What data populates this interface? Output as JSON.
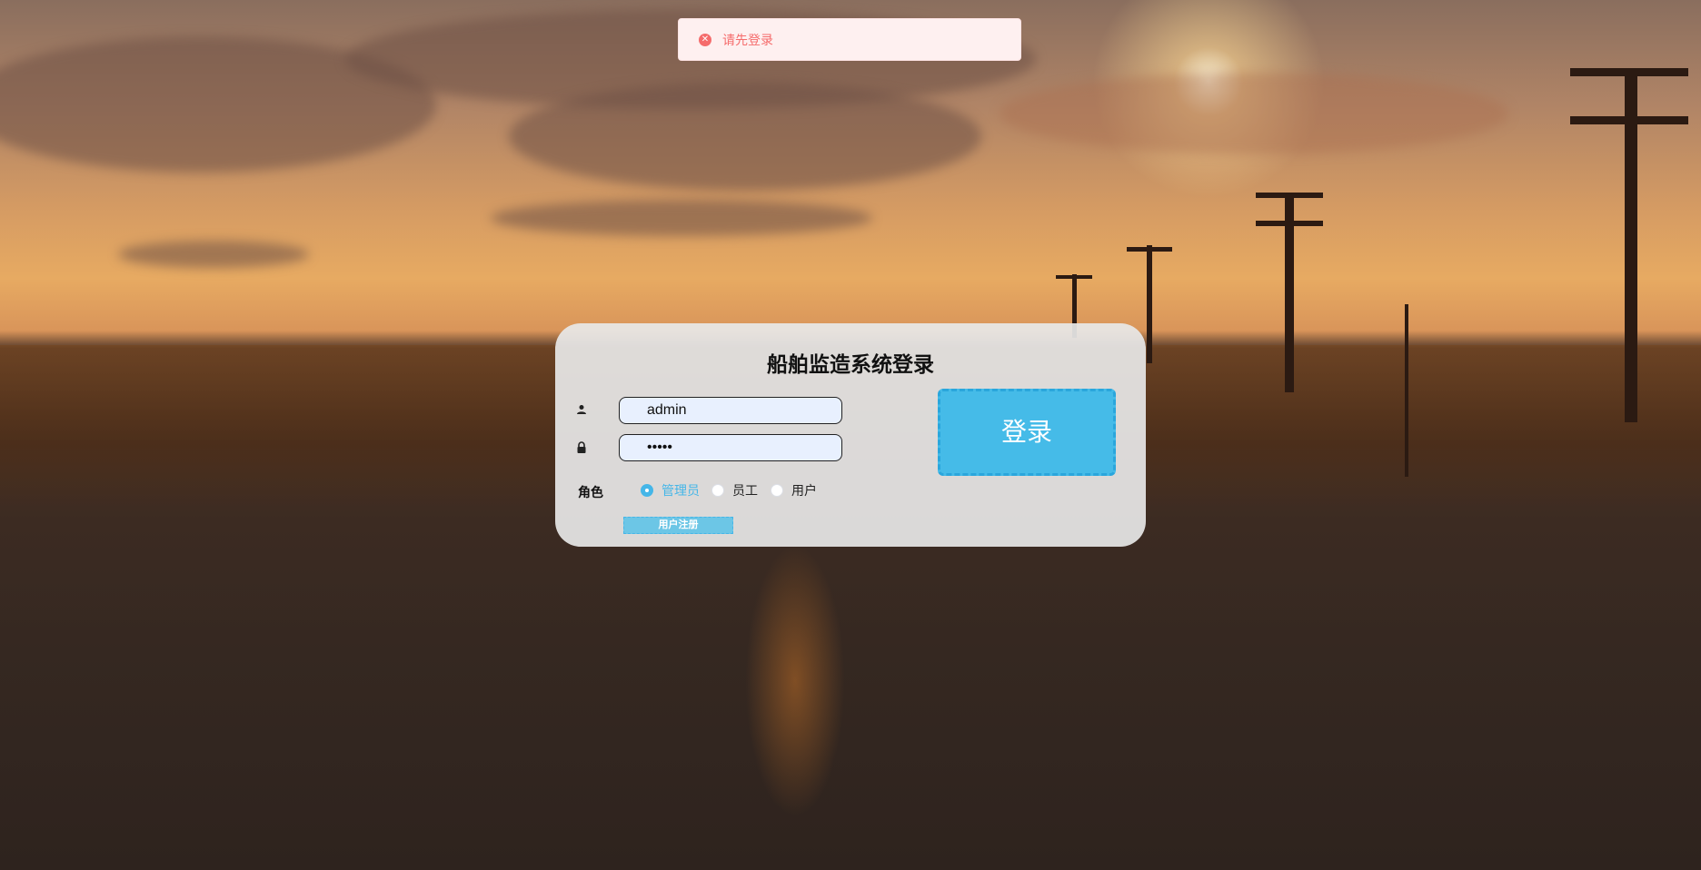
{
  "toast": {
    "icon": "error-circle-icon",
    "message": "请先登录",
    "color": "#f56c6c"
  },
  "login": {
    "title": "船舶监造系统登录",
    "username": {
      "icon": "user-icon",
      "value": "admin"
    },
    "password": {
      "icon": "lock-icon",
      "value": "•••••"
    },
    "role_label": "角色",
    "roles": [
      {
        "label": "管理员",
        "checked": true
      },
      {
        "label": "员工",
        "checked": false
      },
      {
        "label": "用户",
        "checked": false
      }
    ],
    "register_label": "用户注册",
    "submit_label": "登录",
    "accent_color": "#45bbe8"
  }
}
